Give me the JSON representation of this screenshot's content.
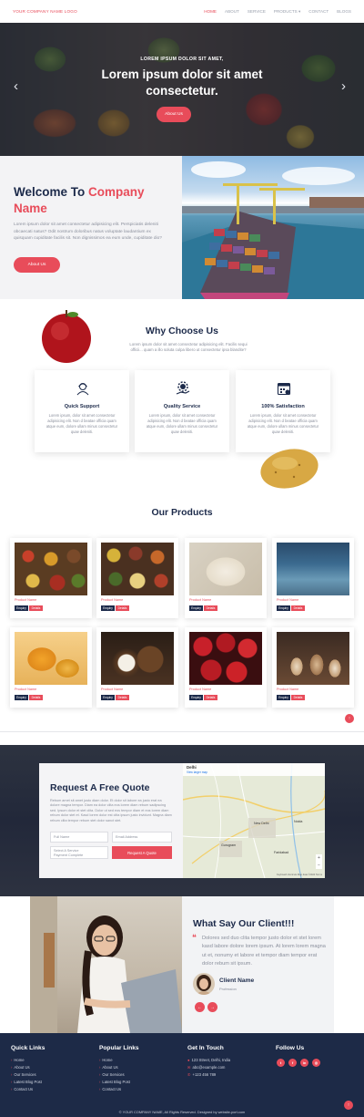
{
  "nav": {
    "logo": "YOUR COMPANY NAME LOGO",
    "items": [
      "HOME",
      "ABOUT",
      "SERVICE",
      "PRODUCTS ▾",
      "CONTACT",
      "BLOGS"
    ]
  },
  "hero": {
    "kicker": "LOREM IPSUM DOLOR SIT AMET,",
    "title": "Lorem ipsum dolor sit amet consectetur.",
    "button": "About Us",
    "prev": "‹",
    "next": "›"
  },
  "welcome": {
    "title_prefix": "Welcome To ",
    "title_highlight": "Company Name",
    "text": "Lorem ipsum dolor sit amet consectetur adipisicing elit. Perspiciatis deleniti obcaecati natus? Odit nostrum doloribus natus voluptate laudantium ex quisquam cupiditate facilis sit. Non dignissimos ea eum unde, cupiditate dio?",
    "button": "About Us"
  },
  "why": {
    "title": "Why Choose Us",
    "text": "Lorem ipsum dolor sit amet consectetur adipisicing elit. Facilis sequi officii... quam a illo soluta culpa libero ut consectetur ipsa blandite?",
    "cards": [
      {
        "title": "Quick Support",
        "icon": "support-agent-icon",
        "text": "Lorem ipsum, dolor sit amet consectetur adipisicing elit. Non d beatae officia quam atque eum, dolore ullam minus consectetur quae deleniti."
      },
      {
        "title": "Quality Service",
        "icon": "gear-hand-icon",
        "text": "Lorem ipsum, dolor sit amet consectetur adipisicing elit. Non d beatae officia quam atque eum, dolore ullam minus consectetur quae deleniti."
      },
      {
        "title": "100% Satisfaction",
        "icon": "calendar-check-icon",
        "text": "Lorem ipsum, dolor sit amet consectetur adipisicing elit. Non d beatae officia quam atque eum, dolore ullam minus consectetur quae deleniti."
      }
    ]
  },
  "products": {
    "title": "Our Products",
    "enquiry_label": "Enquiry",
    "details_label": "Details",
    "items": [
      {
        "name": "Product Name"
      },
      {
        "name": "Product Name"
      },
      {
        "name": "Product Name"
      },
      {
        "name": "Product Name"
      },
      {
        "name": "Product Name"
      },
      {
        "name": "Product Name"
      },
      {
        "name": "Product Name"
      },
      {
        "name": "Product Name"
      }
    ]
  },
  "quote": {
    "title": "Request A Free Quote",
    "text": "Rebum amet sit amet justo diam dolor. Et dolor sit labore ea justo erat ea dolore magna tempor. Diam ea dolor clita eos lorem diam rebum sadipscing sed. Ipsum dolor et stet clita. Dolor ut sed eos tempor diam et eos lorem diam rebum dolor stet et. Kasd lorem dolor est clita ipsum justo invidunt. Magna diam rebum clita tempor rebum stet dolor sanct stet.",
    "full_name_placeholder": "Full Name",
    "email_placeholder": "Email Address",
    "select_label": "Select A Service",
    "select_value": "Payment Complete",
    "button": "Request A Quote",
    "map_label": "Delhi",
    "map_link": "View larger map",
    "map_places": [
      "New Delhi",
      "Faridabad",
      "Gurugram",
      "Noida"
    ],
    "map_footer": "Keyboard shortcuts  Map data ©2024  Terms"
  },
  "testimonial": {
    "title": "What Say Our Client!!!",
    "quote_mark": "❝",
    "text": "Dolores sed duo clita tempor justo dolor et stet lorem kasd labore dolore lorem ipsum. At lorem lorem magna ut et, nonumy et labore et tempor diam tempor erat dolor rebum sit ipsum.",
    "name": "Client Name",
    "role": "Profession",
    "prev": "←",
    "next": "→"
  },
  "footer": {
    "quick_links": {
      "title": "Quick Links",
      "items": [
        "Home",
        "About Us",
        "Our Services",
        "Latest Blog Post",
        "Contact Us"
      ]
    },
    "popular_links": {
      "title": "Popular Links",
      "items": [
        "Home",
        "About Us",
        "Our Services",
        "Latest Blog Post",
        "Contact Us"
      ]
    },
    "contact": {
      "title": "Get In Touch",
      "address": "123 Street, Delhi, India",
      "email": "abc@example.com",
      "phone": "+123 456 789"
    },
    "follow": {
      "title": "Follow Us",
      "icons": [
        "twitter-icon",
        "facebook-icon",
        "linkedin-icon",
        "instagram-icon"
      ],
      "glyphs": [
        "t",
        "f",
        "in",
        "◎"
      ]
    },
    "copyright": "© YOUR COMPANY NAME, All Rights Reserved. Designed by website-port.com"
  },
  "scroll_top": "↑",
  "colors": {
    "accent": "#e84c5a",
    "navy": "#1c2a4a",
    "footer": "#1d2a47"
  }
}
